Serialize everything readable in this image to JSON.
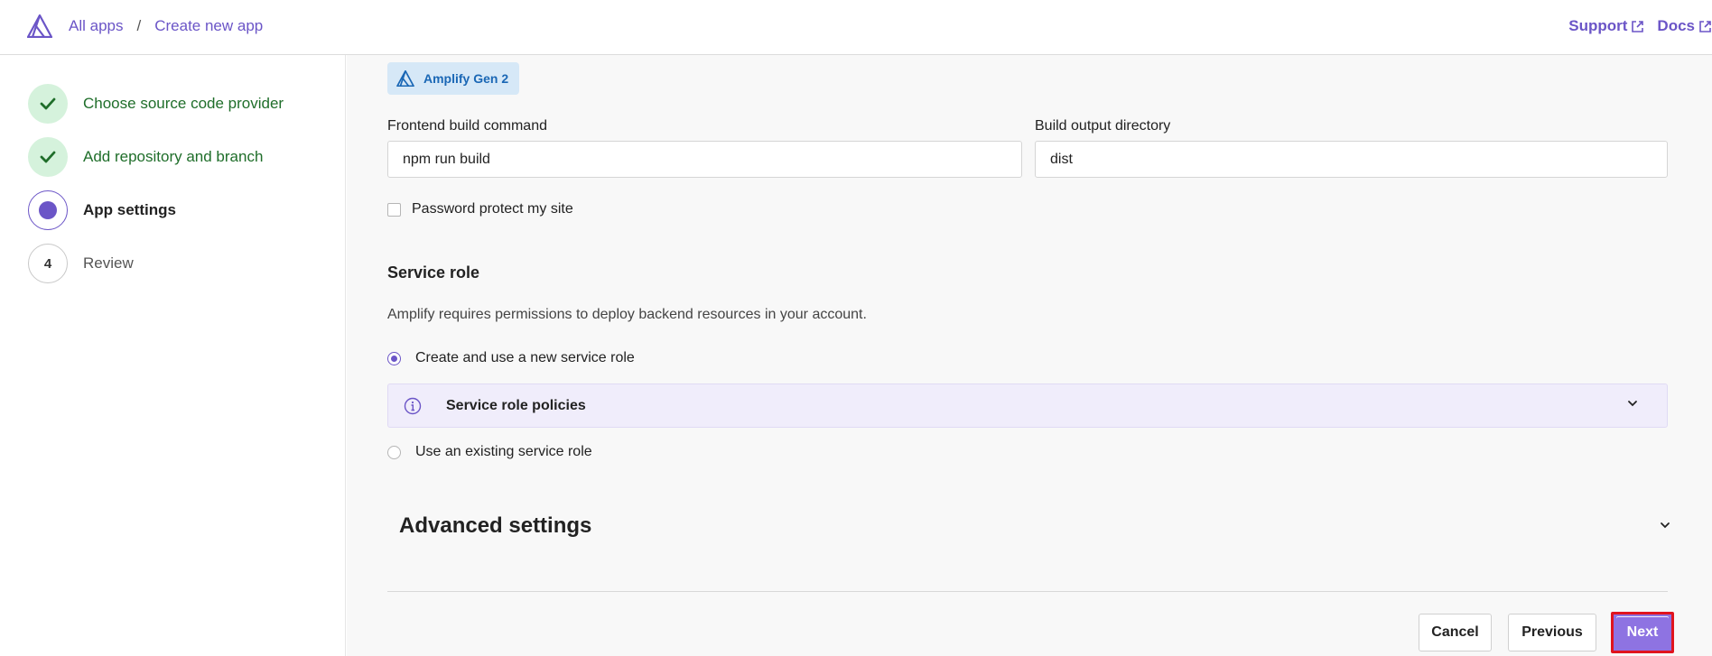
{
  "header": {
    "breadcrumb": [
      {
        "label": "All apps"
      },
      {
        "label": "Create new app"
      }
    ],
    "separator": "/",
    "support_label": "Support",
    "docs_label": "Docs"
  },
  "steps": [
    {
      "number": "1",
      "label": "Choose source code provider",
      "state": "done"
    },
    {
      "number": "2",
      "label": "Add repository and branch",
      "state": "done"
    },
    {
      "number": "3",
      "label": "App settings",
      "state": "current"
    },
    {
      "number": "4",
      "label": "Review",
      "state": "todo"
    }
  ],
  "main": {
    "badge_label": "Amplify Gen 2",
    "frontend_build": {
      "label": "Frontend build command",
      "value": "npm run build"
    },
    "build_output": {
      "label": "Build output directory",
      "value": "dist"
    },
    "password_protect_label": "Password protect my site",
    "password_protect_checked": false,
    "service_role": {
      "title": "Service role",
      "description": "Amplify requires permissions to deploy backend resources in your account.",
      "option_new": "Create and use a new service role",
      "option_new_selected": true,
      "policies_label": "Service role policies",
      "option_existing": "Use an existing service role",
      "option_existing_selected": false
    },
    "advanced_settings_label": "Advanced settings"
  },
  "footer": {
    "cancel_label": "Cancel",
    "previous_label": "Previous",
    "next_label": "Next"
  },
  "colors": {
    "accent": "#6b55c7",
    "next_button": "#8e73e2",
    "highlight_border": "#e0141e",
    "done_step": "#d5f2dc",
    "done_text": "#1f6e2a",
    "badge_bg": "#d6e8f7",
    "policy_bg": "#f0edfb"
  }
}
